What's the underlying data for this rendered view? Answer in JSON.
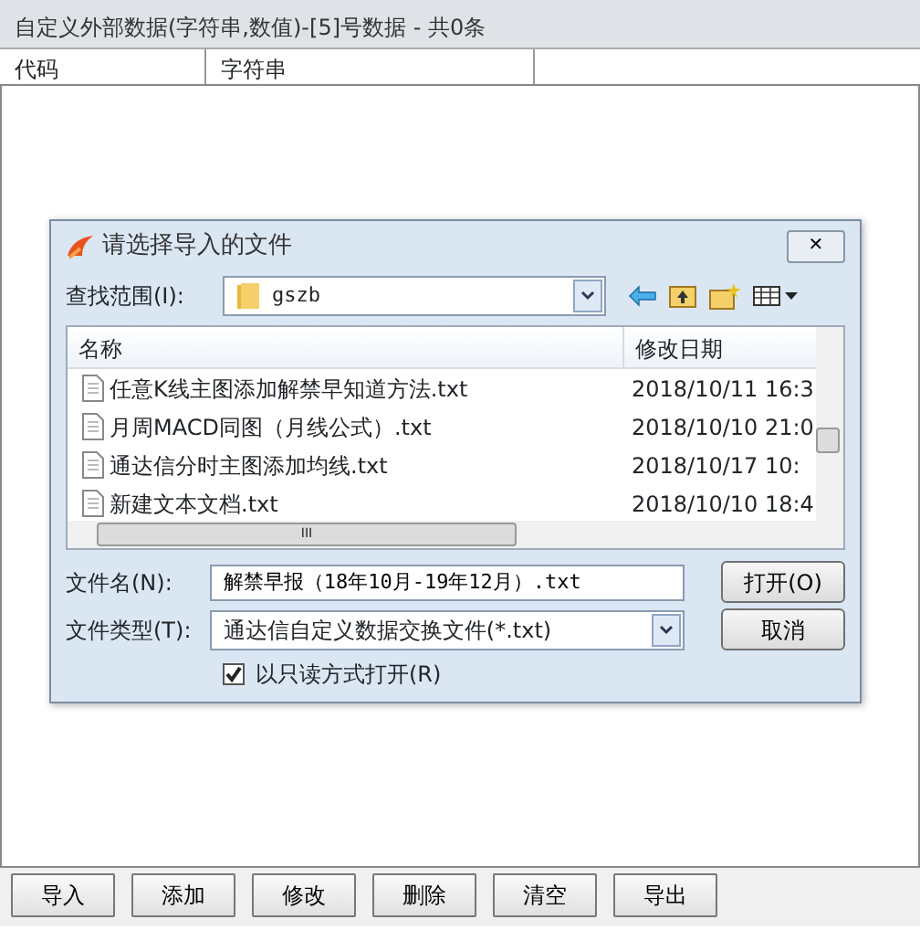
{
  "window": {
    "title": "自定义外部数据(字符串,数值)-[5]号数据 - 共0条"
  },
  "table": {
    "columns": [
      "代码",
      "字符串"
    ]
  },
  "buttons": [
    "导入",
    "添加",
    "修改",
    "删除",
    "清空",
    "导出"
  ],
  "dialog": {
    "title": "请选择导入的文件",
    "close": "✕",
    "look_in": {
      "label": "查找范围(I):",
      "value": "gszb"
    },
    "list": {
      "columns": [
        "名称",
        "修改日期"
      ],
      "rows": [
        {
          "name": "任意K线主图添加解禁早知道方法.txt",
          "date": "2018/10/11 16:3"
        },
        {
          "name": "月周MACD同图（月线公式）.txt",
          "date": "2018/10/10 21:0"
        },
        {
          "name": "通达信分时主图添加均线.txt",
          "date": "2018/10/17 10:"
        },
        {
          "name": "新建文本文档.txt",
          "date": "2018/10/10 18:4"
        }
      ],
      "hscroll": "III"
    },
    "file_name": {
      "label": "文件名(N):",
      "value": "解禁早报（18年10月-19年12月）.txt"
    },
    "file_type": {
      "label": "文件类型(T):",
      "value": "通达信自定义数据交换文件(*.txt)"
    },
    "read_only": {
      "label": "以只读方式打开(R)",
      "checked": true
    },
    "open_button": "打开(O)",
    "cancel_button": "取消"
  }
}
